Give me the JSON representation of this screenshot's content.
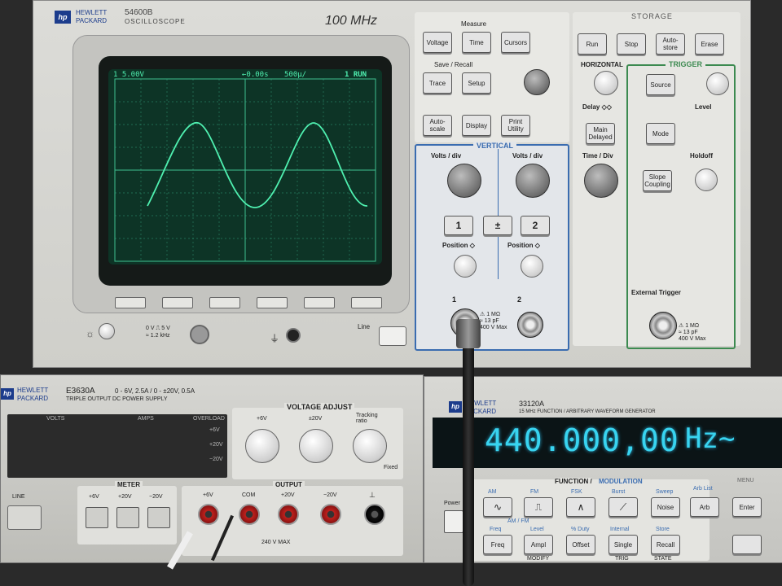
{
  "oscilloscope": {
    "brand_line1": "HEWLETT",
    "brand_line2": "PACKARD",
    "model": "54600B",
    "type": "OSCILLOSCOPE",
    "bandwidth": "100 MHz",
    "screen": {
      "ch_scale": "1  5.00V",
      "time_offset": "←0.00s",
      "time_scale": "500µ/",
      "trigger_status": "1 RUN"
    },
    "measure": {
      "title": "Measure",
      "voltage": "Voltage",
      "time": "Time",
      "cursors": "Cursors"
    },
    "save_recall": {
      "title": "Save / Recall",
      "trace": "Trace",
      "setup": "Setup"
    },
    "autoscale": "Auto-scale",
    "display": "Display",
    "print_utility": "Print Utility",
    "storage": {
      "title": "STORAGE",
      "run": "Run",
      "stop": "Stop",
      "autostore": "Auto-store",
      "erase": "Erase"
    },
    "horizontal": {
      "title": "HORIZONTAL",
      "delay": "Delay ◇◇",
      "main_delayed": "Main Delayed",
      "time_div": "Time / Div"
    },
    "trigger": {
      "title": "TRIGGER",
      "source": "Source",
      "level": "Level",
      "mode": "Mode",
      "holdoff": "Holdoff",
      "slope_coupling": "Slope Coupling",
      "external_trigger": "External Trigger",
      "ext_spec": "⚠ 1 MΩ\n≈ 13 pF\n400 V Max"
    },
    "vertical": {
      "title": "VERTICAL",
      "volts_div_1": "Volts / div",
      "volts_div_2": "Volts / div",
      "ch1": "1",
      "plusminus": "±",
      "ch2": "2",
      "position_1": "Position ◇",
      "position_2": "Position ◇",
      "input1": "1",
      "input2": "2",
      "spec": "⚠ 1 MΩ\n≈ 13 pF\n400 V Max"
    },
    "probe_comp": "0 V ⎍ 5 V\n≈ 1.2 kHz",
    "line": "Line"
  },
  "power_supply": {
    "brand_line1": "HEWLETT",
    "brand_line2": "PACKARD",
    "model": "E3630A",
    "rating": "0 - 6V, 2.5A / 0 - ±20V, 0.5A",
    "type": "TRIPLE OUTPUT DC POWER SUPPLY",
    "volts": "VOLTS",
    "amps": "AMPS",
    "overload": "OVERLOAD",
    "ovl_6": "+6V",
    "ovl_p20": "+20V",
    "ovl_m20": "−20V",
    "voltage_adjust": "VOLTAGE ADJUST",
    "adj_6": "+6V",
    "adj_20": "±20V",
    "tracking": "Tracking ratio",
    "fixed": "Fixed",
    "meter": "METER",
    "m_6": "+6V",
    "m_p20": "+20V",
    "m_m20": "−20V",
    "output": "OUTPUT",
    "o_6": "+6V",
    "o_com": "COM",
    "o_p20": "+20V",
    "o_m20": "−20V",
    "o_gnd": "⊥",
    "max": "240 V MAX",
    "line": "LINE"
  },
  "function_generator": {
    "brand_line1": "HEWLETT",
    "brand_line2": "PACKARD",
    "model": "33120A",
    "description": "15 MHz FUNCTION / ARBITRARY WAVEFORM GENERATOR",
    "display_value": "440.000,00",
    "display_unit": "Hz~",
    "function_label": "FUNCTION /",
    "modulation_label": "MODULATION",
    "am": "AM",
    "fm": "FM",
    "fsk": "FSK",
    "burst": "Burst",
    "sweep": "Sweep",
    "arb_list": "Arb List",
    "noise": "Noise",
    "arb": "Arb",
    "am_fm": "AM / FM",
    "freq_lbl": "Freq",
    "level_lbl": "Level",
    "duty_lbl": "% Duty",
    "internal_lbl": "Internal",
    "store_lbl": "Store",
    "freq": "Freq",
    "ampl": "Ampl",
    "offset": "Offset",
    "single": "Single",
    "recall": "Recall",
    "modify": "MODIFY",
    "trig": "TRIG",
    "state": "STATE",
    "enter": "Enter",
    "menu": "MENU",
    "power": "Power"
  },
  "colors": {
    "panel": "#d8d8d4",
    "screen_bg": "#0f3a2a",
    "trace": "#4ff0b0",
    "vertical_border": "#3a6cb0",
    "trigger_border": "#3c8a50",
    "vfd": "#38d4f0"
  }
}
